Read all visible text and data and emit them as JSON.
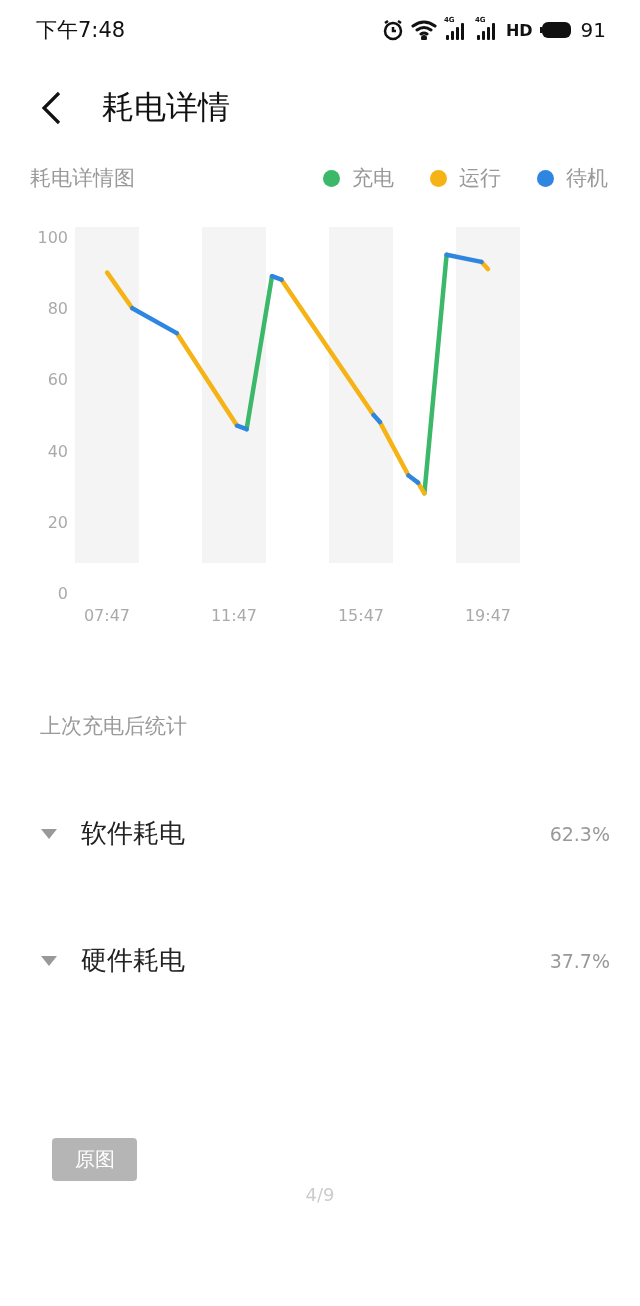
{
  "status_bar": {
    "time": "下午7:48",
    "networks": [
      {
        "label": "4G"
      },
      {
        "label": "4G"
      }
    ],
    "hd": "HD",
    "battery": "91"
  },
  "header": {
    "title": "耗电详情"
  },
  "chart": {
    "chart_data": {
      "type": "line",
      "title": "耗电详情图",
      "x": [
        7.79,
        8.58,
        8.58,
        9.98,
        9.98,
        11.88,
        11.88,
        12.18,
        12.18,
        12.98,
        12.98,
        13.28,
        13.28,
        16.18,
        16.18,
        16.38,
        16.38,
        17.28,
        17.28,
        17.58,
        17.58,
        17.78,
        17.78,
        18.48,
        18.48,
        19.58,
        19.58,
        19.78
      ],
      "series": [
        {
          "name": "充电",
          "color": "#3cb86a",
          "values": [
            null,
            null,
            null,
            null,
            null,
            null,
            null,
            null,
            46,
            89,
            null,
            null,
            null,
            null,
            null,
            null,
            null,
            null,
            null,
            null,
            null,
            null,
            28,
            95,
            null,
            null,
            null,
            null
          ]
        },
        {
          "name": "运行",
          "color": "#f5b316",
          "values": [
            90,
            80,
            null,
            null,
            73,
            47,
            null,
            null,
            null,
            null,
            null,
            null,
            88,
            50,
            null,
            null,
            48,
            33,
            null,
            null,
            31,
            28,
            null,
            null,
            null,
            null,
            93,
            91
          ]
        },
        {
          "name": "待机",
          "color": "#2f86e0",
          "values": [
            null,
            null,
            80,
            73,
            null,
            null,
            47,
            46,
            null,
            null,
            89,
            88,
            null,
            null,
            50,
            48,
            null,
            null,
            33,
            31,
            null,
            null,
            null,
            null,
            95,
            93,
            null,
            null
          ]
        }
      ],
      "xlim": [
        7.7833,
        19.7833
      ],
      "ylim": [
        0,
        100
      ],
      "xticks": [
        {
          "value": 7.7833,
          "label": "07:47"
        },
        {
          "value": 11.7833,
          "label": "11:47"
        },
        {
          "value": 15.7833,
          "label": "15:47"
        },
        {
          "value": 19.7833,
          "label": "19:47"
        }
      ],
      "yticks": [
        0,
        20,
        40,
        60,
        80,
        100
      ]
    }
  },
  "stats": {
    "title": "上次充电后统计",
    "rows": [
      {
        "label": "软件耗电",
        "value": "62.3%"
      },
      {
        "label": "硬件耗电",
        "value": "37.7%"
      }
    ]
  },
  "footer": {
    "button": "原图",
    "page": "4/9"
  }
}
